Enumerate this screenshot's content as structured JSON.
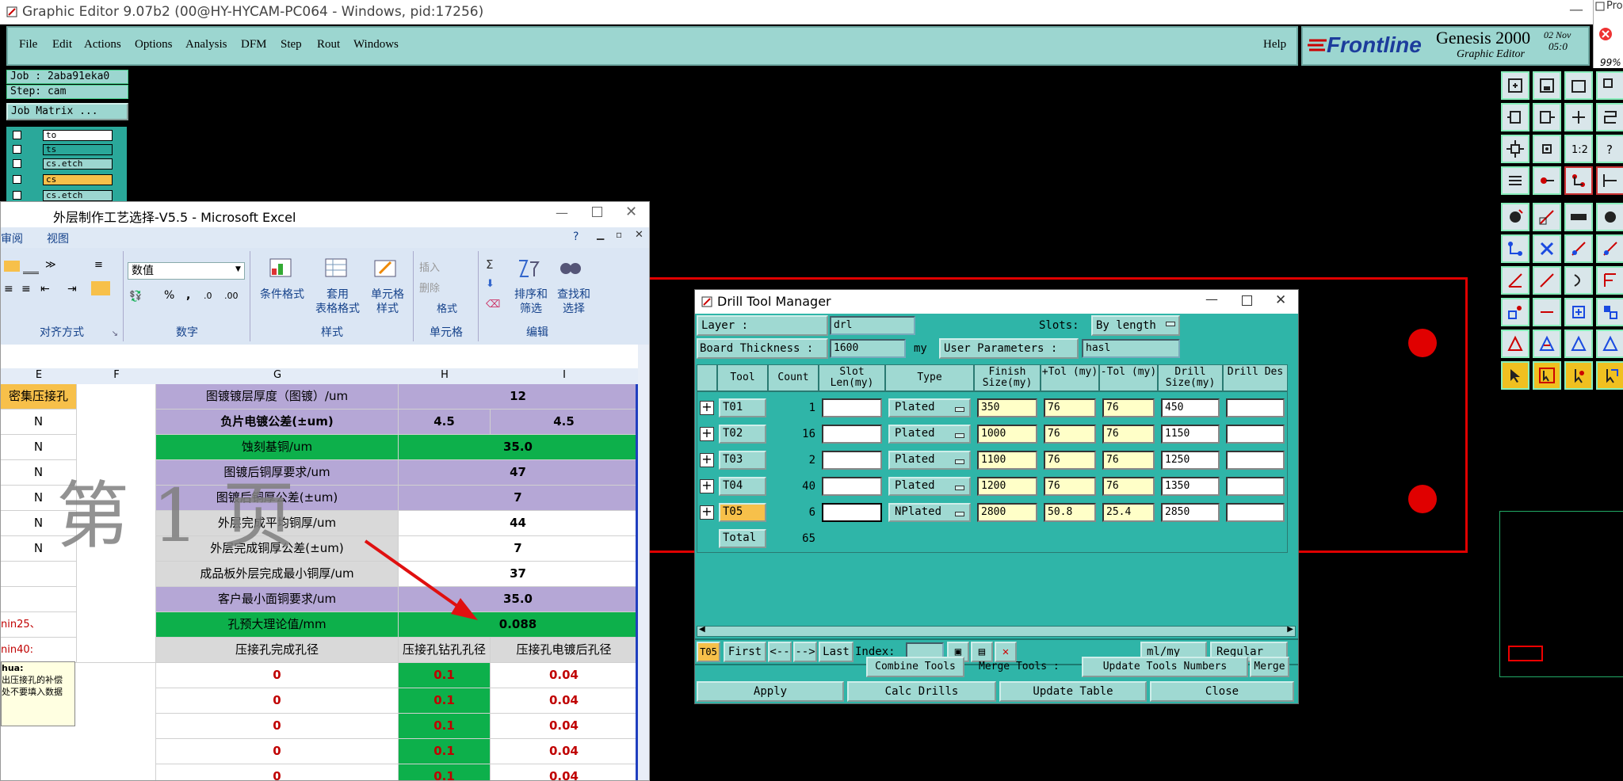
{
  "genesis": {
    "window_title": "Graphic Editor 9.07b2 (00@HY-HYCAM-PC064 - Windows, pid:17256)",
    "menu": [
      "File",
      "Edit",
      "Actions",
      "Options",
      "Analysis",
      "DFM",
      "Step",
      "Rout",
      "Windows"
    ],
    "help": "Help",
    "brand": "Frontline",
    "product": "Genesis 2000",
    "subtitle": "Graphic Editor",
    "date_fragment": "02  Nov",
    "time_fragment": "05:0",
    "job_line": "Job : 2aba91eka0",
    "step_line": "Step: cam",
    "job_matrix": "Job Matrix ...",
    "layers": [
      "to",
      "ts",
      "cs.etch",
      "cs",
      "cs.etch"
    ],
    "side_panel": {
      "title": "Pro",
      "percent": "99%"
    }
  },
  "excel": {
    "title": "外层制作工艺选择-V5.5 - Microsoft Excel",
    "tabs": [
      "审阅",
      "视图"
    ],
    "ribbon": {
      "number_format": "数值",
      "group_align": "对齐方式",
      "group_number": "数字",
      "group_style": "样式",
      "group_cells": "单元格",
      "group_edit": "编辑",
      "cond_format": "条件格式",
      "table_format_1": "套用",
      "table_format_2": "表格格式",
      "cell_style_1": "单元格",
      "cell_style_2": "样式",
      "insert": "插入",
      "delete": "删除",
      "format": "格式",
      "sort_1": "排序和",
      "sort_2": "筛选",
      "find_1": "查找和",
      "find_2": "选择",
      "percent": "%",
      "comma": ","
    },
    "columns": [
      "E",
      "F",
      "G",
      "H",
      "I"
    ],
    "col_e": [
      "密集压接孔",
      "N",
      "N",
      "N",
      "N",
      "N",
      "N"
    ],
    "watermark": "第 1 页",
    "comment_lines": [
      "hua:",
      "出压接孔的补偿",
      "处不要填入数据"
    ],
    "side_notes": [
      "nin25、",
      "nin40:"
    ],
    "rows": [
      {
        "label": "图镀镀层厚度（图镀）/um",
        "h": "12",
        "i": "",
        "merge": true,
        "style": "purple"
      },
      {
        "label": "负片电镀公差(±um)",
        "h": "4.5",
        "i": "4.5",
        "merge": false,
        "style": "purple",
        "bold": true
      },
      {
        "label": "蚀刻基铜/um",
        "h": "35.0",
        "i": "",
        "merge": true,
        "style": "green"
      },
      {
        "label": "图镀后铜厚要求/um",
        "h": "47",
        "i": "",
        "merge": true,
        "style": "purple"
      },
      {
        "label": "图镀后铜厚公差(±um)",
        "h": "7",
        "i": "",
        "merge": true,
        "style": "purple"
      },
      {
        "label": "外层完成平均铜厚/um",
        "h": "44",
        "i": "",
        "merge": true,
        "style": "grey"
      },
      {
        "label": "外层完成铜厚公差(±um)",
        "h": "7",
        "i": "",
        "merge": true,
        "style": "grey"
      },
      {
        "label": "成品板外层完成最小铜厚/um",
        "h": "37",
        "i": "",
        "merge": true,
        "style": "grey"
      },
      {
        "label": "客户最小面铜要求/um",
        "h": "35.0",
        "i": "",
        "merge": true,
        "style": "purple"
      },
      {
        "label": "孔预大理论值/mm",
        "h": "0.088",
        "i": "",
        "merge": true,
        "style": "green"
      }
    ],
    "sub_headers": [
      "压接孔完成孔径",
      "压接孔钻孔孔径",
      "压接孔电镀后孔径"
    ],
    "data_rows": [
      [
        "0",
        "0.1",
        "0.04"
      ],
      [
        "0",
        "0.1",
        "0.04"
      ],
      [
        "0",
        "0.1",
        "0.04"
      ],
      [
        "0",
        "0.1",
        "0.04"
      ],
      [
        "0",
        "0.1",
        "0.04"
      ]
    ]
  },
  "dtm": {
    "title": "Drill Tool Manager",
    "layer_label": "Layer          :",
    "layer_value": "drl",
    "slots_label": "Slots:",
    "slots_value": "By length",
    "thickness_label": "Board Thickness :",
    "thickness_value": "1600",
    "thickness_unit": "my",
    "user_params_label": "User Parameters :",
    "user_params_value": "hasl",
    "headers": [
      "Tool",
      "Count",
      "Slot Len(my)",
      "Type",
      "Finish Size(my)",
      "+Tol (my)",
      "-Tol (my)",
      "Drill Size(my)",
      "Drill Des"
    ],
    "tools": [
      {
        "name": "T01",
        "count": "1",
        "type": "Plated",
        "finish": "350",
        "ptol": "76",
        "mtol": "76",
        "drill": "450"
      },
      {
        "name": "T02",
        "count": "16",
        "type": "Plated",
        "finish": "1000",
        "ptol": "76",
        "mtol": "76",
        "drill": "1150"
      },
      {
        "name": "T03",
        "count": "2",
        "type": "Plated",
        "finish": "1100",
        "ptol": "76",
        "mtol": "76",
        "drill": "1250"
      },
      {
        "name": "T04",
        "count": "40",
        "type": "Plated",
        "finish": "1200",
        "ptol": "76",
        "mtol": "76",
        "drill": "1350"
      },
      {
        "name": "T05",
        "count": "6",
        "type": "NPlated",
        "finish": "2800",
        "ptol": "50.8",
        "mtol": "25.4",
        "drill": "2850"
      }
    ],
    "total_label": "Total",
    "total_count": "65",
    "current_tool": "T05",
    "nav": {
      "first": "First",
      "prev": "<--",
      "next": "-->",
      "last": "Last",
      "index_label": "Index:"
    },
    "unit_value": "ml/my",
    "mode_value": "Regular",
    "combine": "Combine Tools",
    "merge_label": "Merge Tools :",
    "update_numbers": "Update Tools Numbers",
    "merge": "Merge",
    "apply": "Apply",
    "calc": "Calc Drills",
    "update_table": "Update Table",
    "close": "Close"
  },
  "colors": {
    "genesis_teal": "#9cd6d0",
    "dtm_bg": "#2fb5a8",
    "board_red": "#e00000",
    "excel_purple": "#b5a7d6",
    "excel_green": "#0db04b",
    "selected_tool": "#f7c04a"
  }
}
